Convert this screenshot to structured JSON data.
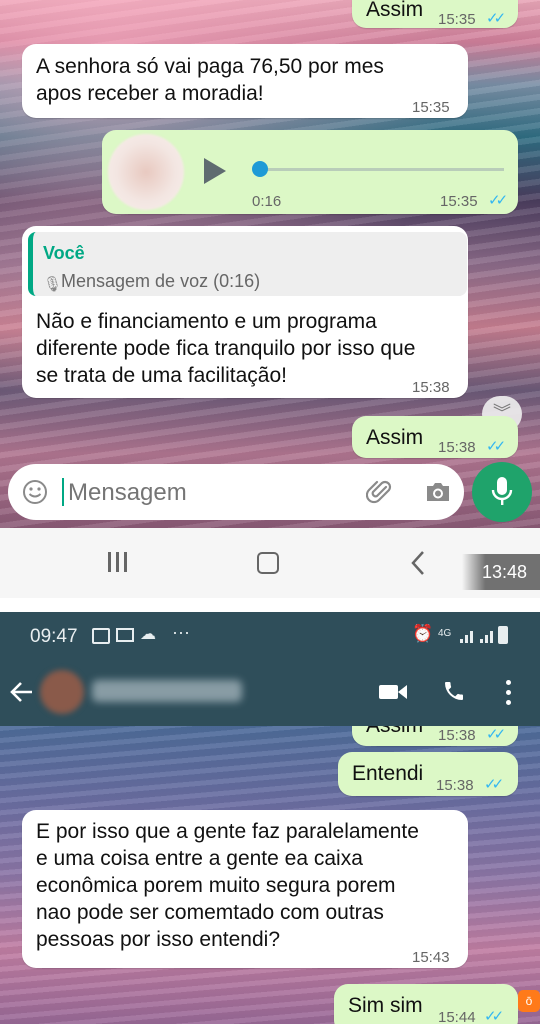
{
  "top_chat": {
    "msg1": {
      "text": "Assim",
      "time": "15:35"
    },
    "msg2": {
      "text": "A senhora só vai paga 76,50 por mes\napos receber a moradia!",
      "time": "15:35"
    },
    "voice": {
      "duration": "0:16",
      "time": "15:35"
    },
    "reply": {
      "quoted_author": "Você",
      "quoted_text": "Mensagem de voz (0:16)",
      "text": "Não e financiamento e um programa\ndiferente pode fica tranquilo por isso que\nse trata de uma facilitação!",
      "time": "15:38"
    },
    "msg5": {
      "text": "Assim",
      "time": "15:38"
    }
  },
  "input_bar": {
    "placeholder": "Mensagem"
  },
  "nav": {
    "clock": "13:48"
  },
  "status_bar": {
    "time": "09:47",
    "network": "4G"
  },
  "bottom_chat": {
    "msg1": {
      "text": "Assim",
      "time": "15:38"
    },
    "msg2": {
      "text": "Entendi",
      "time": "15:38"
    },
    "msg3": {
      "text": "E por isso que a gente faz paralelamente\ne uma coisa entre a gente ea caixa\neconômica porem muito segura porem\nnao pode ser comemtado com outras\npessoas por isso entendi?",
      "time": "15:43"
    },
    "msg4": {
      "text": "Sim sim",
      "time": "15:44"
    }
  },
  "colors": {
    "outgoing": "#dcf8c6",
    "incoming": "#ffffff",
    "tick_read": "#34b7f1",
    "fab": "#1fa36b",
    "header": "#2f4e5a",
    "accent": "#00a884"
  }
}
